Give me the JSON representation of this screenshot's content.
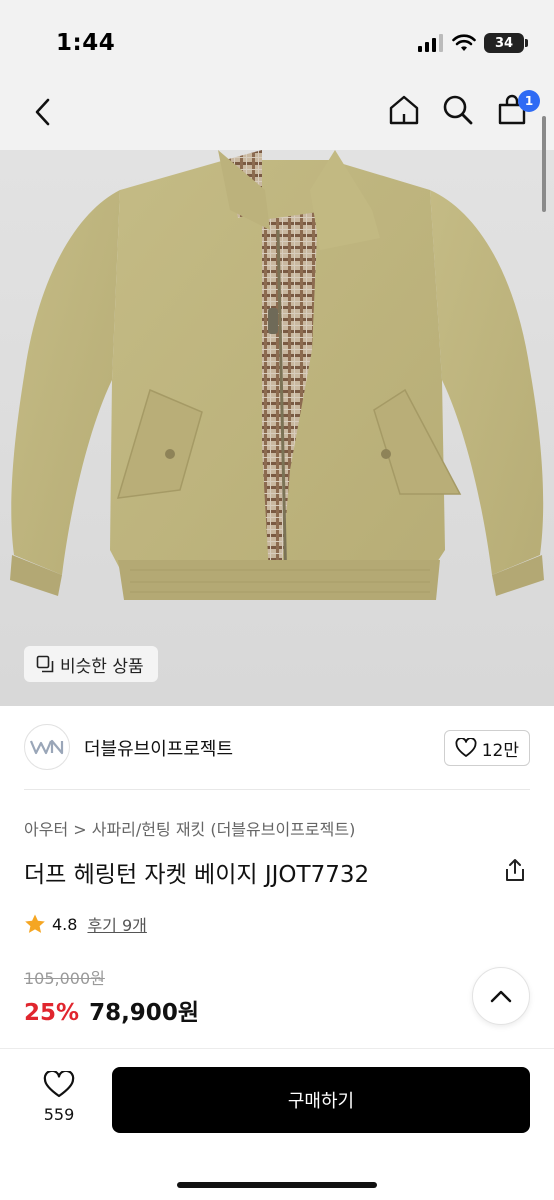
{
  "status_bar": {
    "time": "1:44",
    "battery": "34"
  },
  "nav": {
    "cart_count": "1"
  },
  "hero": {
    "similar_label": "비슷한 상품"
  },
  "brand": {
    "name": "더블유브이프로젝트",
    "like_count": "12만"
  },
  "product": {
    "breadcrumb": "아우터 > 사파리/헌팅 재킷 (더블유브이프로젝트)",
    "title": "더프 헤링턴 자켓 베이지 JJOT7732",
    "rating": "4.8",
    "review_link": "후기 9개",
    "original_price": "105,000원",
    "discount": "25%",
    "sale_price": "78,900원"
  },
  "bottom": {
    "wish_count": "559",
    "buy_label": "구매하기"
  },
  "colors": {
    "accent": "#2f6bf4",
    "discount": "#e0262e",
    "star": "#f5a623",
    "buy_button": "#000000"
  },
  "icons": [
    "back-icon",
    "home-icon",
    "search-icon",
    "cart-icon",
    "similar-icon",
    "heart-icon",
    "share-icon",
    "star-icon",
    "chevron-up-icon"
  ]
}
